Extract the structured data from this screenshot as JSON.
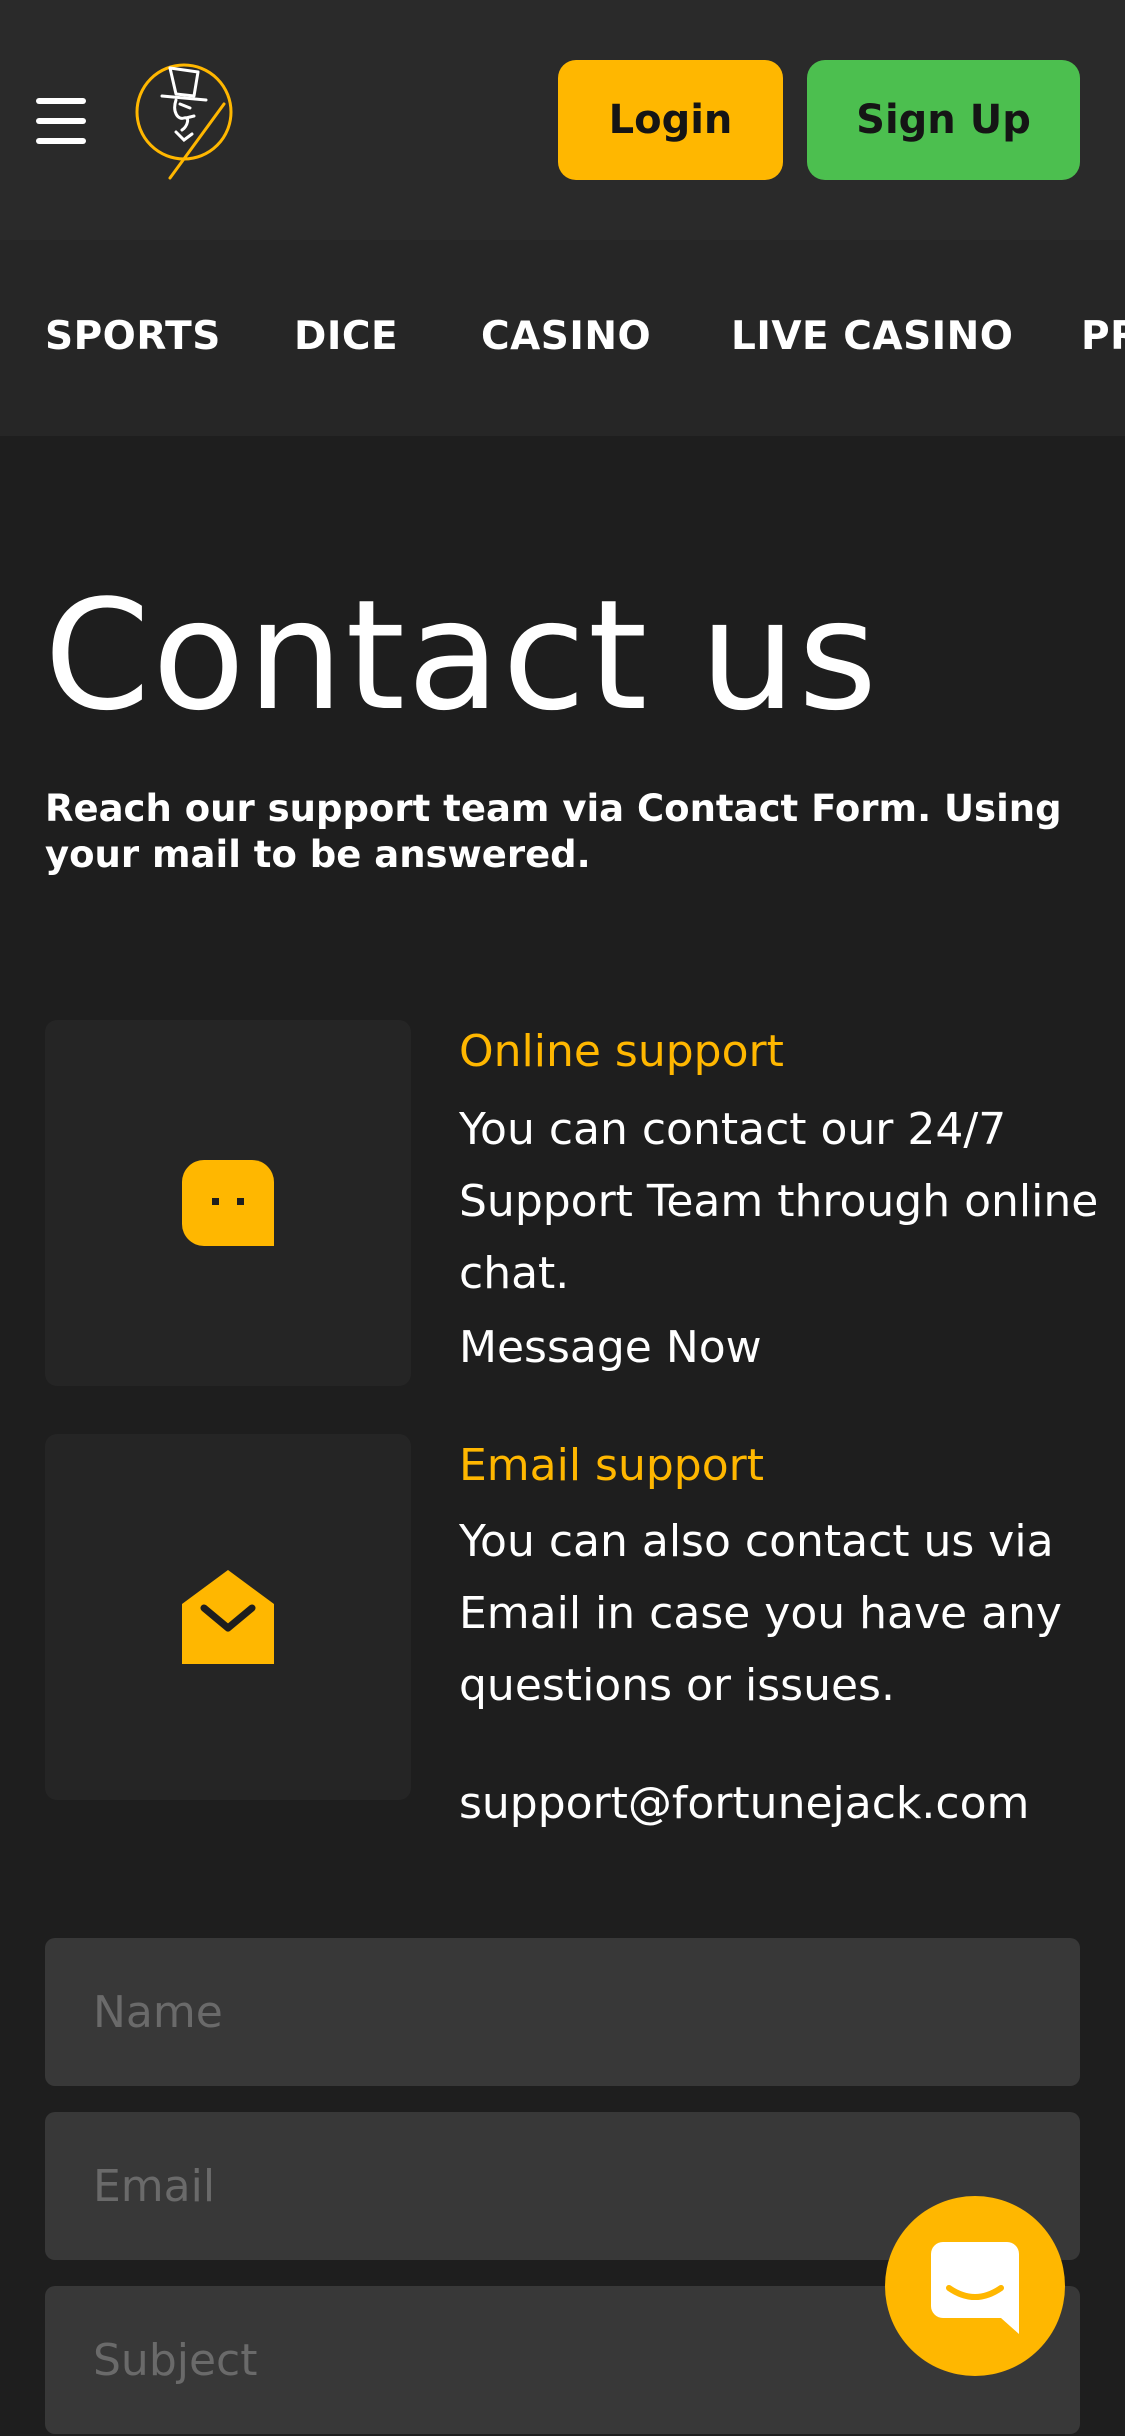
{
  "header": {
    "menu_icon": "hamburger-menu-icon",
    "logo_icon": "fortunejack-logo",
    "login_label": "Login",
    "signup_label": "Sign Up"
  },
  "nav": {
    "items": [
      "SPORTS",
      "DICE",
      "CASINO",
      "LIVE CASINO",
      "PR"
    ]
  },
  "page": {
    "title": "Contact us",
    "subtitle": "Reach our support team via Contact Form. Using your mail to be answered."
  },
  "online_support": {
    "icon": "chat-bubble-icon",
    "heading": "Online support",
    "text": "You can contact our 24/7 Support Team through online chat.",
    "link": "Message Now"
  },
  "email_support": {
    "icon": "envelope-icon",
    "heading": "Email support",
    "text": "You can also contact us via Email in case you have any questions or issues.",
    "email": "support@fortunejack.com"
  },
  "form": {
    "name_placeholder": "Name",
    "email_placeholder": "Email",
    "subject_placeholder": "Subject"
  },
  "chat_widget": {
    "icon": "chat-launcher-icon"
  },
  "colors": {
    "accent": "#ffb700",
    "signup": "#4cbf4f",
    "background": "#1e1e1e",
    "header": "#2a2a2a"
  }
}
